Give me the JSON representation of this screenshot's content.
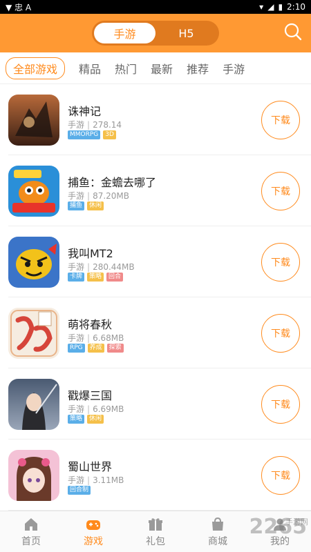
{
  "statusbar": {
    "time": "2:10",
    "left_glyphs": "▼ 忠 A"
  },
  "header": {
    "segments": [
      "手游",
      "H5"
    ],
    "active_segment": "手游"
  },
  "tabs": [
    "全部游戏",
    "精品",
    "热门",
    "最新",
    "推荐",
    "手游"
  ],
  "games": [
    {
      "name": "诛神记",
      "type": "手游",
      "size": "278.14",
      "tags": [
        {
          "label": "MMORPG",
          "color": "#5aaee8"
        },
        {
          "label": "3D",
          "color": "#f5c04a"
        }
      ],
      "action": "下载",
      "icon": "dragon-warrior-icon"
    },
    {
      "name": "捕鱼：金蟾去哪了",
      "type": "手游",
      "size": "87.20MB",
      "tags": [
        {
          "label": "捕鱼",
          "color": "#5aaee8"
        },
        {
          "label": "休闲",
          "color": "#f5c04a"
        }
      ],
      "action": "下载",
      "icon": "fish-game-icon"
    },
    {
      "name": "我叫MT2",
      "type": "手游",
      "size": "280.44MB",
      "tags": [
        {
          "label": "卡牌",
          "color": "#5aaee8"
        },
        {
          "label": "策略",
          "color": "#f5c04a"
        },
        {
          "label": "回合",
          "color": "#f08a8a"
        }
      ],
      "action": "下载",
      "icon": "mt2-icon"
    },
    {
      "name": "萌将春秋",
      "type": "手游",
      "size": "6.68MB",
      "tags": [
        {
          "label": "RPG",
          "color": "#5aaee8"
        },
        {
          "label": "养成",
          "color": "#f5c04a"
        },
        {
          "label": "探索",
          "color": "#f08a8a"
        }
      ],
      "action": "下载",
      "icon": "mengjiang-icon"
    },
    {
      "name": "戳爆三国",
      "type": "手游",
      "size": "6.69MB",
      "tags": [
        {
          "label": "策略",
          "color": "#5aaee8"
        },
        {
          "label": "休闲",
          "color": "#f5c04a"
        }
      ],
      "action": "下载",
      "icon": "sanguo-icon"
    },
    {
      "name": "蜀山世界",
      "type": "手游",
      "size": "3.11MB",
      "tags": [
        {
          "label": "回合制",
          "color": "#5aaee8"
        }
      ],
      "action": "下载",
      "icon": "shushan-icon"
    }
  ],
  "bottom_nav": [
    {
      "label": "首页",
      "icon": "home-icon"
    },
    {
      "label": "游戏",
      "icon": "gamepad-icon",
      "active": true
    },
    {
      "label": "礼包",
      "icon": "gift-icon"
    },
    {
      "label": "商城",
      "icon": "shop-icon"
    },
    {
      "label": "我的",
      "icon": "user-icon"
    }
  ],
  "watermark": {
    "main": "2265",
    "sub": "手游网"
  },
  "colors": {
    "accent": "#ff8a1c",
    "header_bg": "#ff9933"
  }
}
